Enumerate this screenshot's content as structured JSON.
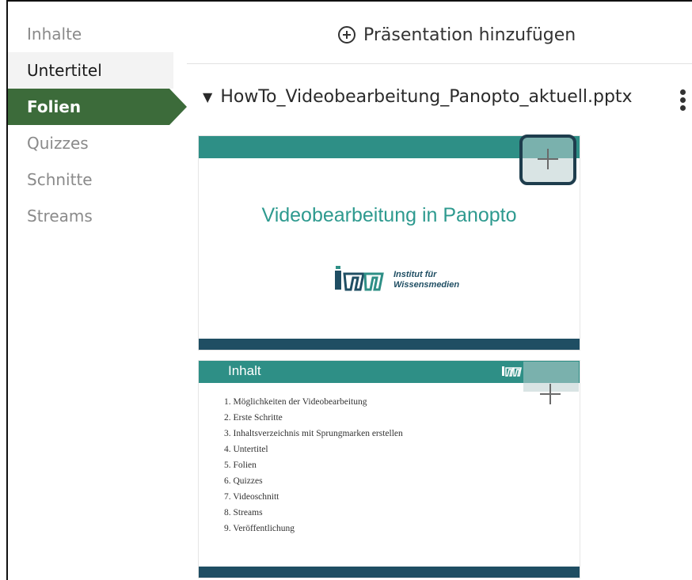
{
  "sidebar": {
    "items": [
      {
        "label": "Inhalte",
        "state": "muted"
      },
      {
        "label": "Untertitel",
        "state": "hover"
      },
      {
        "label": "Folien",
        "state": "active"
      },
      {
        "label": "Quizzes",
        "state": "muted"
      },
      {
        "label": "Schnitte",
        "state": "muted"
      },
      {
        "label": "Streams",
        "state": "muted"
      }
    ]
  },
  "header": {
    "add_presentation_label": "Präsentation hinzufügen",
    "add_icon": "plus-circle-icon"
  },
  "presentation": {
    "filename": "HowTo_Videobearbeitung_Panopto_aktuell.pptx",
    "expand_icon": "triangle-down-icon",
    "menu_icon": "kebab-menu-icon"
  },
  "slides": [
    {
      "title": "Videobearbeitung in Panopto",
      "logo_text_line1": "Institut für",
      "logo_text_line2": "Wissensmedien"
    },
    {
      "title": "Inhalt",
      "items": [
        "1.  Möglichkeiten der Videobearbeitung",
        "2.  Erste Schritte",
        "3.  Inhaltsverzeichnis mit Sprungmarken erstellen",
        "4.  Untertitel",
        "5.  Folien",
        "6.  Quizzes",
        "7.  Videoschnitt",
        "8.  Streams",
        "9.  Veröffentlichung"
      ]
    }
  ],
  "colors": {
    "active_tab": "#3c6b3a",
    "slide_teal": "#2e8f86",
    "slide_navy": "#1f4e63",
    "selected_border": "#1e3d4d"
  }
}
